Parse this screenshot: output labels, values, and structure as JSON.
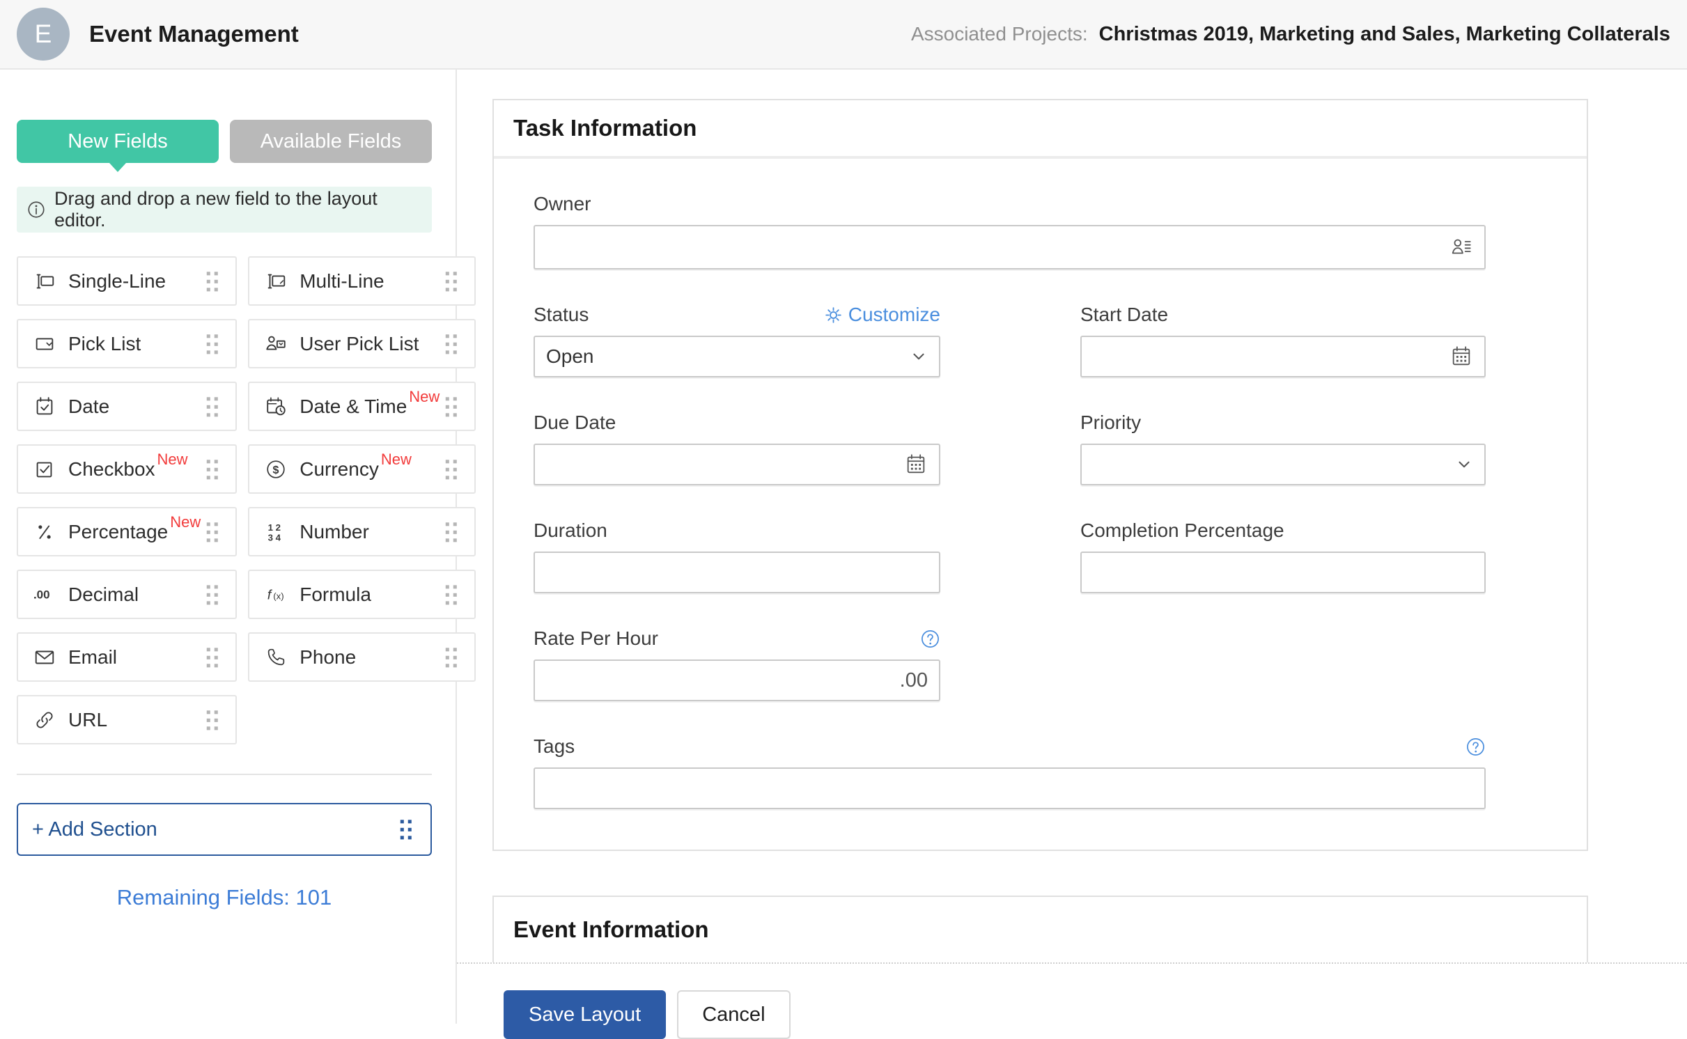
{
  "header": {
    "avatar_letter": "E",
    "title": "Event Management",
    "associated_label": "Associated Projects:",
    "projects": "Christmas 2019, Marketing and Sales, Marketing Collaterals"
  },
  "sidebar": {
    "tabs": [
      {
        "label": "New Fields",
        "active": true
      },
      {
        "label": "Available Fields",
        "active": false
      }
    ],
    "info_text": "Drag and drop a new field to the layout editor.",
    "fields": [
      {
        "label": "Single-Line",
        "icon": "single-line-icon"
      },
      {
        "label": "Multi-Line",
        "icon": "multi-line-icon"
      },
      {
        "label": "Pick List",
        "icon": "pick-list-icon"
      },
      {
        "label": "User Pick List",
        "icon": "user-pick-list-icon"
      },
      {
        "label": "Date",
        "icon": "date-icon"
      },
      {
        "label": "Date & Time",
        "icon": "date-time-icon",
        "badge": "New"
      },
      {
        "label": "Checkbox",
        "icon": "checkbox-icon",
        "badge": "New"
      },
      {
        "label": "Currency",
        "icon": "currency-icon",
        "badge": "New"
      },
      {
        "label": "Percentage",
        "icon": "percentage-icon",
        "badge": "New"
      },
      {
        "label": "Number",
        "icon": "number-icon"
      },
      {
        "label": "Decimal",
        "icon": "decimal-icon"
      },
      {
        "label": "Formula",
        "icon": "formula-icon"
      },
      {
        "label": "Email",
        "icon": "email-icon"
      },
      {
        "label": "Phone",
        "icon": "phone-icon"
      },
      {
        "label": "URL",
        "icon": "url-icon"
      }
    ],
    "add_section_label": "+ Add Section",
    "remaining_fields_text": "Remaining Fields: 101"
  },
  "main": {
    "sections": [
      {
        "title": "Task Information"
      },
      {
        "title": "Event Information"
      }
    ],
    "form": {
      "owner": {
        "label": "Owner"
      },
      "status": {
        "label": "Status",
        "value": "Open",
        "customize_label": "Customize"
      },
      "start_date": {
        "label": "Start Date"
      },
      "due_date": {
        "label": "Due Date"
      },
      "priority": {
        "label": "Priority",
        "value": ""
      },
      "duration": {
        "label": "Duration"
      },
      "completion": {
        "label": "Completion Percentage"
      },
      "rate_per_hour": {
        "label": "Rate Per Hour",
        "value": ".00"
      },
      "tags": {
        "label": "Tags"
      }
    },
    "buttons": {
      "save": "Save Layout",
      "cancel": "Cancel"
    }
  },
  "icons": {
    "info": "info-circle-icon",
    "drag_handle": "drag-handle-icon",
    "owner_input": "user-list-icon",
    "customize": "gear-icon",
    "select": "chevron-down-icon",
    "date_input": "calendar-icon",
    "help": "question-circle-icon"
  },
  "colors": {
    "accent_teal": "#41c6a5",
    "inactive_tab_gray": "#b9b9b9",
    "link_blue": "#4a8ede",
    "section_blue": "#2b5a9e",
    "save_button_blue": "#2d5ba6",
    "badge_red": "#f23b3b",
    "info_bg": "#e9f6f1",
    "header_bg": "#f7f7f7"
  }
}
